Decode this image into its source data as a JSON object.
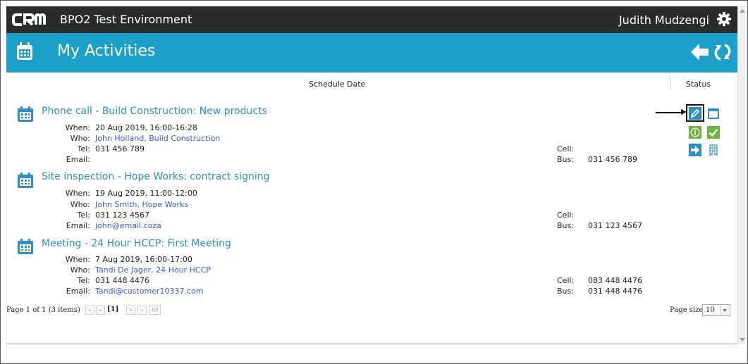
{
  "app": {
    "brand": "CRM",
    "environment": "BPO2 Test Environment",
    "user": "Judith Mudzengi"
  },
  "page": {
    "title": "My Activities"
  },
  "columns": {
    "schedule_date": "Schedule Date",
    "status": "Status"
  },
  "labels": {
    "when": "When:",
    "who": "Who:",
    "tel": "Tel:",
    "email": "Email:",
    "cell": "Cell:",
    "bus": "Bus:"
  },
  "activities": [
    {
      "title": "Phone call - Build Construction: New products",
      "when": "20 Aug 2019, 16:00-16:28",
      "who": "John Holland, Build Construction",
      "tel": "031 456 789",
      "email": "",
      "cell": "",
      "bus": "031 456 789"
    },
    {
      "title": "Site inspection - Hope Works: contract signing",
      "when": "19 Aug 2019, 11:00-12:00",
      "who": "John Smith, Hope Works",
      "tel": "031 123 4567",
      "email": "john@email.coza",
      "cell": "",
      "bus": "031 123 4567"
    },
    {
      "title": "Meeting - 24 Hour HCCP: First Meeting",
      "when": "7 Aug 2019, 16:00-17:00",
      "who": "Tandi De Jager, 24 Hour HCCP",
      "tel": "031 448 4476",
      "email": "Tandi@customer10337.com",
      "cell": "083 448 4476",
      "bus": "031 448 4476"
    }
  ],
  "status_icons": [
    "edit-icon",
    "calendar-icon",
    "info-icon",
    "check-icon",
    "forward-arrow-icon",
    "building-icon"
  ],
  "pager": {
    "summary": "Page 1 of 1 (3 items)",
    "first": "«",
    "prev": "<",
    "current": "[1]",
    "next": ">",
    "last": "»",
    "all": "All",
    "page_size_label": "Page size:",
    "page_size": "10"
  },
  "colors": {
    "topbar": "#2b2b2b",
    "titlebar": "#1aa0c9",
    "accent": "#2c8fc7",
    "link": "#3a55e8",
    "check": "#6cb33f"
  }
}
